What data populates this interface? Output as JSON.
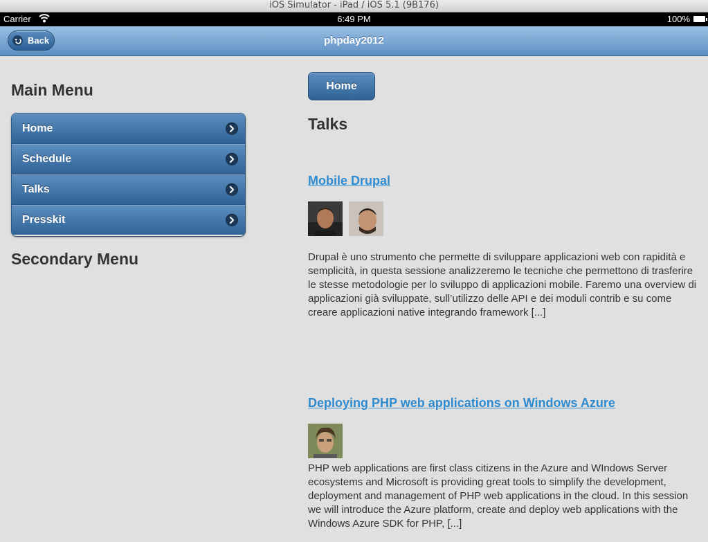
{
  "simulator": {
    "title": "iOS Simulator - iPad / iOS 5.1 (9B176)"
  },
  "status_bar": {
    "carrier": "Carrier",
    "time": "6:49 PM",
    "battery": "100%"
  },
  "navbar": {
    "title": "phpday2012",
    "back_label": "Back"
  },
  "sidebar": {
    "main_heading": "Main Menu",
    "items": [
      {
        "label": "Home"
      },
      {
        "label": "Schedule"
      },
      {
        "label": "Talks"
      },
      {
        "label": "Presskit"
      }
    ],
    "secondary_heading": "Secondary Menu"
  },
  "content": {
    "home_button": "Home",
    "heading": "Talks",
    "talks": [
      {
        "title": "Mobile Drupal",
        "description": "Drupal è uno strumento che permette di sviluppare applicazioni web con rapidità e semplicità, in questa sessione analizzeremo le tecniche che permettono di trasferire le stesse metodologie per lo sviluppo di applicazioni mobile. Faremo una overview di applicazioni già sviluppate, sull’utilizzo delle API e dei moduli contrib e su come creare applicazioni native integrando framework [...]"
      },
      {
        "title": "Deploying PHP web applications on Windows Azure",
        "description": "PHP web applications are first class citizens in the Azure and WIndows Server ecosystems and Microsoft is providing great tools to simplify the development, deployment and management of PHP web applications in the cloud. In this session we will introduce the Azure platform, create and deploy web applications with the Windows Azure SDK for PHP, [...]"
      }
    ]
  }
}
